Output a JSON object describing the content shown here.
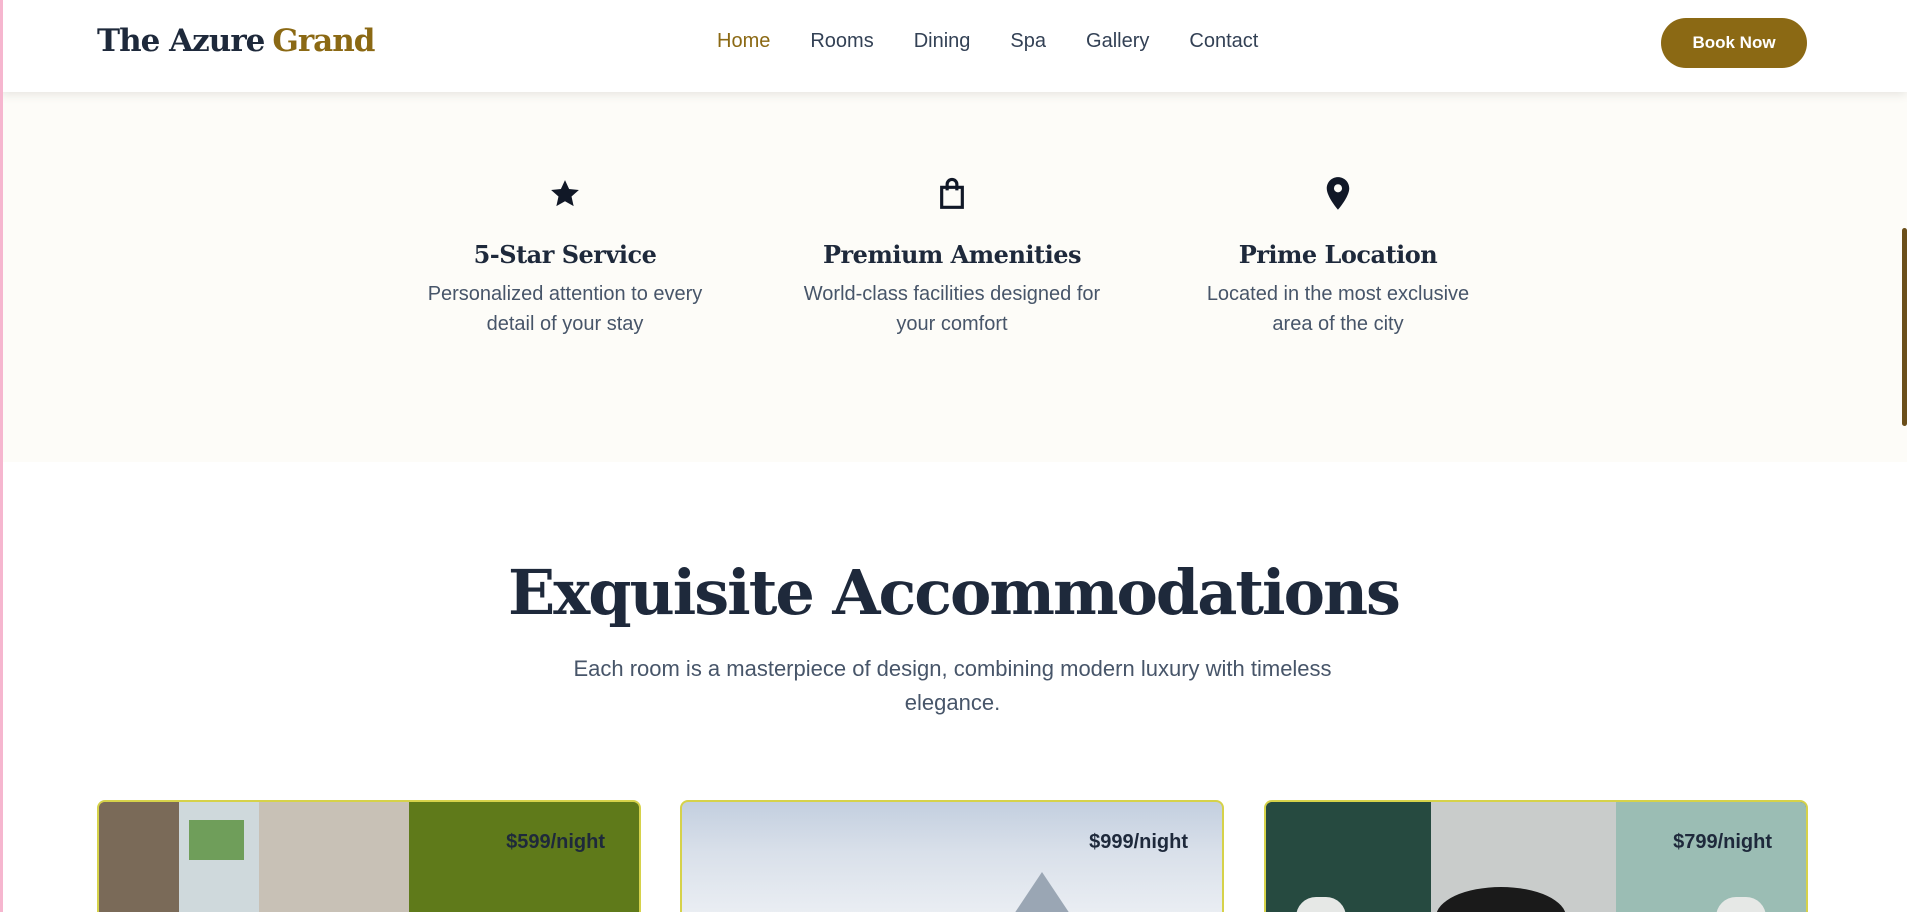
{
  "brand": {
    "name_part1": "The Azure",
    "name_part2": "Grand",
    "accent_color": "#8b6914"
  },
  "nav": {
    "items": [
      {
        "label": "Home",
        "active": true
      },
      {
        "label": "Rooms",
        "active": false
      },
      {
        "label": "Dining",
        "active": false
      },
      {
        "label": "Spa",
        "active": false
      },
      {
        "label": "Gallery",
        "active": false
      },
      {
        "label": "Contact",
        "active": false
      }
    ],
    "cta_label": "Book Now"
  },
  "features": [
    {
      "icon": "star-icon",
      "title": "5-Star Service",
      "description": "Personalized attention to every detail of your stay"
    },
    {
      "icon": "shopping-bag-icon",
      "title": "Premium Amenities",
      "description": "World-class facilities designed for your comfort"
    },
    {
      "icon": "map-pin-icon",
      "title": "Prime Location",
      "description": "Located in the most exclusive area of the city"
    }
  ],
  "accommodations": {
    "title": "Exquisite Accommodations",
    "subtitle": "Each room is a masterpiece of design, combining modern luxury with timeless elegance.",
    "rooms": [
      {
        "price": "$599/night"
      },
      {
        "price": "$999/night"
      },
      {
        "price": "$799/night"
      }
    ]
  }
}
